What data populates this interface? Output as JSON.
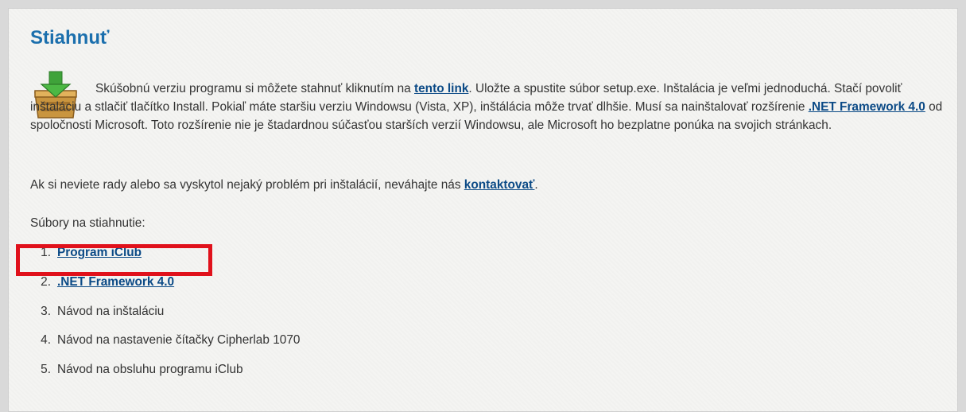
{
  "section": {
    "title": "Stiahnuť"
  },
  "intro": {
    "text_before_link": "Skúšobnú verziu programu si môžete stahnuť kliknutím na ",
    "link1": "tento link",
    "text_after_link1": ". Uložte a spustite súbor setup.exe. Inštalácia je veľmi jednoduchá. Stačí povoliť inštaláciu a stlačiť tlačítko Install. Pokiaľ máte staršiu verziu Windowsu (Vista, XP), inštálácia môže trvať dlhšie. Musí sa nainštalovať rozšírenie ",
    "link2": ".NET Framework 4.0",
    "text_after_link2": " od spoločnosti Microsoft. Toto rozšírenie nie je štadardnou súčasťou starších verzií Windowsu, ale Microsoft ho bezplatne ponúka na svojich stránkach."
  },
  "help": {
    "text": "Ak si neviete rady alebo sa vyskytol nejaký problém pri inštalácií, neváhajte nás ",
    "link": "kontaktovať",
    "end": "."
  },
  "files": {
    "heading": "Súbory na stiahnutie:",
    "items": [
      {
        "num": "1.",
        "label": "Program iClub",
        "is_link": true
      },
      {
        "num": "2.",
        "label": ".NET Framework 4.0",
        "is_link": true
      },
      {
        "num": "3.",
        "label": "Návod na inštaláciu",
        "is_link": false
      },
      {
        "num": "4.",
        "label": "Návod na nastavenie čítačky Cipherlab 1070",
        "is_link": false
      },
      {
        "num": "5.",
        "label": "Návod na obsluhu programu iClub",
        "is_link": false
      }
    ]
  },
  "colors": {
    "title": "#1b6fad",
    "link": "#0b4a86",
    "highlight": "#e0111b"
  },
  "icons": {
    "download": "download-box-icon"
  }
}
